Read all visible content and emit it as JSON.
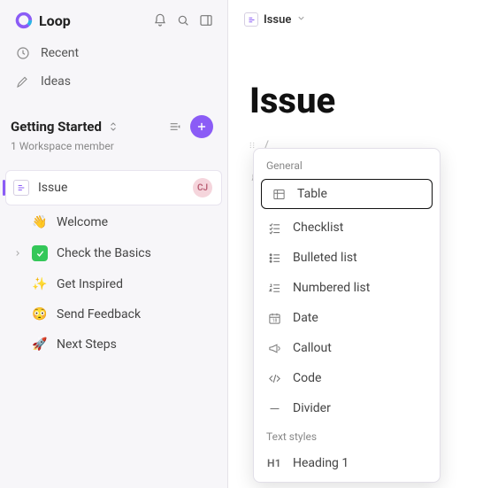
{
  "brand": {
    "name": "Loop"
  },
  "nav": {
    "recent": "Recent",
    "ideas": "Ideas"
  },
  "workspace": {
    "title": "Getting Started",
    "subtitle": "1 Workspace member"
  },
  "pages": [
    {
      "label": "Issue"
    },
    {
      "label": "Welcome"
    },
    {
      "label": "Check the Basics"
    },
    {
      "label": "Get Inspired"
    },
    {
      "label": "Send Feedback"
    },
    {
      "label": "Next Steps"
    }
  ],
  "avatar": {
    "initials": "CJ"
  },
  "doc": {
    "breadcrumb_label": "Issue",
    "title": "Issue",
    "slash": "/"
  },
  "slash_menu": {
    "general_label": "General",
    "items": {
      "table": "Table",
      "checklist": "Checklist",
      "bulleted": "Bulleted list",
      "numbered": "Numbered list",
      "date": "Date",
      "callout": "Callout",
      "code": "Code",
      "divider": "Divider"
    },
    "styles_label": "Text styles",
    "styles": {
      "h1_badge": "H1",
      "h1_label": "Heading 1"
    }
  }
}
